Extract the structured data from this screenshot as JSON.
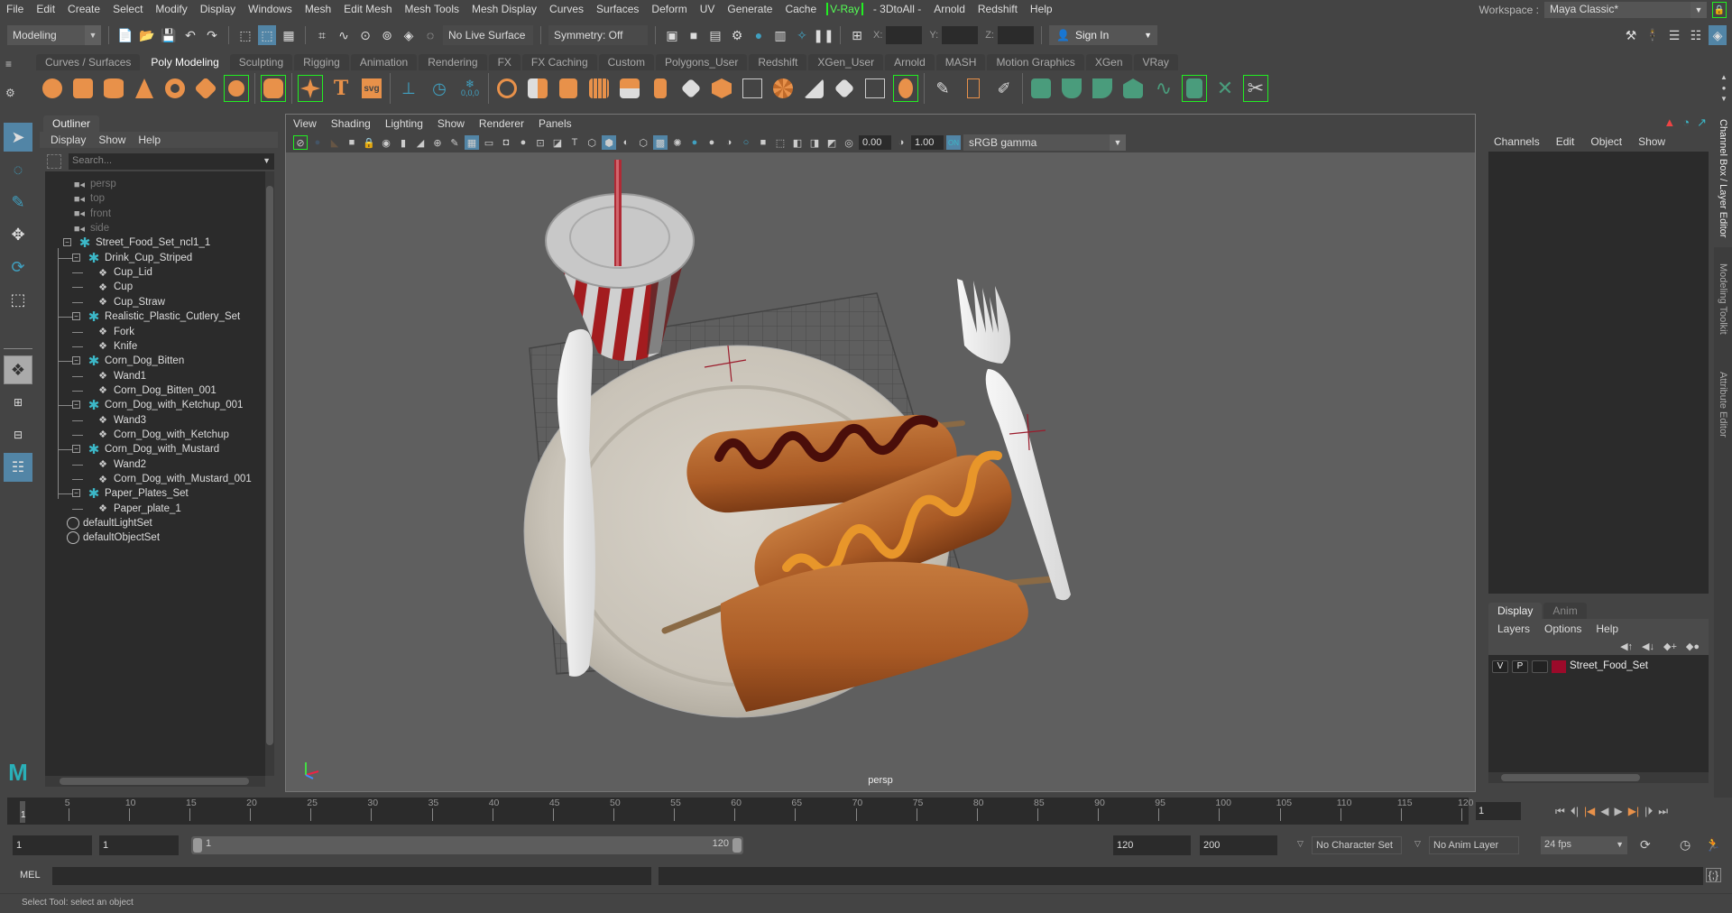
{
  "menubar": {
    "items": [
      "File",
      "Edit",
      "Create",
      "Select",
      "Modify",
      "Display",
      "Windows",
      "Mesh",
      "Edit Mesh",
      "Mesh Tools",
      "Mesh Display",
      "Curves",
      "Surfaces",
      "Deform",
      "UV",
      "Generate",
      "Cache"
    ],
    "vray": "V-Ray",
    "extra": [
      "- 3DtoAll -",
      "Arnold",
      "Redshift",
      "Help"
    ]
  },
  "workspace": {
    "label": "Workspace :",
    "value": "Maya Classic*"
  },
  "statusline": {
    "mode": "Modeling",
    "live_surface": "No Live Surface",
    "symmetry": "Symmetry: Off",
    "x_label": "X:",
    "y_label": "Y:",
    "z_label": "Z:",
    "sign_in": "Sign In"
  },
  "shelf": {
    "tabs": [
      "Curves / Surfaces",
      "Poly Modeling",
      "Sculpting",
      "Rigging",
      "Animation",
      "Rendering",
      "FX",
      "FX Caching",
      "Custom",
      "Polygons_User",
      "Redshift",
      "XGen_User",
      "Arnold",
      "MASH",
      "Motion Graphics",
      "XGen",
      "VRay"
    ],
    "active_tab": "Poly Modeling",
    "label_000": "0,0,0"
  },
  "outliner": {
    "tab": "Outliner",
    "menu": [
      "Display",
      "Show",
      "Help"
    ],
    "search_placeholder": "Search...",
    "items": [
      {
        "label": "persp",
        "type": "camera",
        "depth": 0,
        "dim": true
      },
      {
        "label": "top",
        "type": "camera",
        "depth": 0,
        "dim": true
      },
      {
        "label": "front",
        "type": "camera",
        "depth": 0,
        "dim": true
      },
      {
        "label": "side",
        "type": "camera",
        "depth": 0,
        "dim": true
      },
      {
        "label": "Street_Food_Set_ncl1_1",
        "type": "group",
        "depth": 0
      },
      {
        "label": "Drink_Cup_Striped",
        "type": "group",
        "depth": 1
      },
      {
        "label": "Cup_Lid",
        "type": "mesh",
        "depth": 2
      },
      {
        "label": "Cup",
        "type": "mesh",
        "depth": 2
      },
      {
        "label": "Cup_Straw",
        "type": "mesh",
        "depth": 2
      },
      {
        "label": "Realistic_Plastic_Cutlery_Set",
        "type": "group",
        "depth": 1
      },
      {
        "label": "Fork",
        "type": "mesh",
        "depth": 2
      },
      {
        "label": "Knife",
        "type": "mesh",
        "depth": 2
      },
      {
        "label": "Corn_Dog_Bitten",
        "type": "group",
        "depth": 1
      },
      {
        "label": "Wand1",
        "type": "mesh",
        "depth": 2
      },
      {
        "label": "Corn_Dog_Bitten_001",
        "type": "mesh",
        "depth": 2
      },
      {
        "label": "Corn_Dog_with_Ketchup_001",
        "type": "group",
        "depth": 1
      },
      {
        "label": "Wand3",
        "type": "mesh",
        "depth": 2
      },
      {
        "label": "Corn_Dog_with_Ketchup",
        "type": "mesh",
        "depth": 2
      },
      {
        "label": "Corn_Dog_with_Mustard",
        "type": "group",
        "depth": 1
      },
      {
        "label": "Wand2",
        "type": "mesh",
        "depth": 2
      },
      {
        "label": "Corn_Dog_with_Mustard_001",
        "type": "mesh",
        "depth": 2
      },
      {
        "label": "Paper_Plates_Set",
        "type": "group",
        "depth": 1
      },
      {
        "label": "Paper_plate_1",
        "type": "mesh",
        "depth": 2
      },
      {
        "label": "defaultLightSet",
        "type": "set",
        "depth": 0
      },
      {
        "label": "defaultObjectSet",
        "type": "set",
        "depth": 0
      }
    ]
  },
  "viewport": {
    "menu": [
      "View",
      "Shading",
      "Lighting",
      "Show",
      "Renderer",
      "Panels"
    ],
    "exposure": "0.00",
    "gamma": "1.00",
    "color_space": "sRGB gamma",
    "camera_label": "persp"
  },
  "channel_box": {
    "menu": [
      "Channels",
      "Edit",
      "Object",
      "Show"
    ]
  },
  "layer_editor": {
    "tabs": [
      "Display",
      "Anim"
    ],
    "menu": [
      "Layers",
      "Options",
      "Help"
    ],
    "layers": [
      {
        "v": "V",
        "p": "P",
        "name": "Street_Food_Set",
        "color": "#9b0a2a"
      }
    ]
  },
  "side_tabs": [
    "Channel Box / Layer Editor",
    "Modeling Toolkit",
    "Attribute Editor"
  ],
  "timeline": {
    "ticks": [
      5,
      10,
      15,
      20,
      25,
      30,
      35,
      40,
      45,
      50,
      55,
      60,
      65,
      70,
      75,
      80,
      85,
      90,
      95,
      100,
      105,
      110,
      115,
      120
    ],
    "start": 1,
    "end": 120,
    "current_frame": "1",
    "current_marker": "1"
  },
  "range": {
    "start": "1",
    "anim_start": "1",
    "slider_start": "1",
    "slider_end": "120",
    "end": "120",
    "anim_end": "200",
    "character_set": "No Character Set",
    "anim_layer": "No Anim Layer",
    "fps": "24 fps"
  },
  "command_line": {
    "label": "MEL"
  },
  "help_line": "Select Tool: select an object",
  "colors": {
    "accent": "#5285a6",
    "maya_teal": "#3cb8c8",
    "shelf_orange": "#e8914a",
    "shelf_green": "#4a9c7c",
    "layer_red": "#9b0a2a"
  }
}
